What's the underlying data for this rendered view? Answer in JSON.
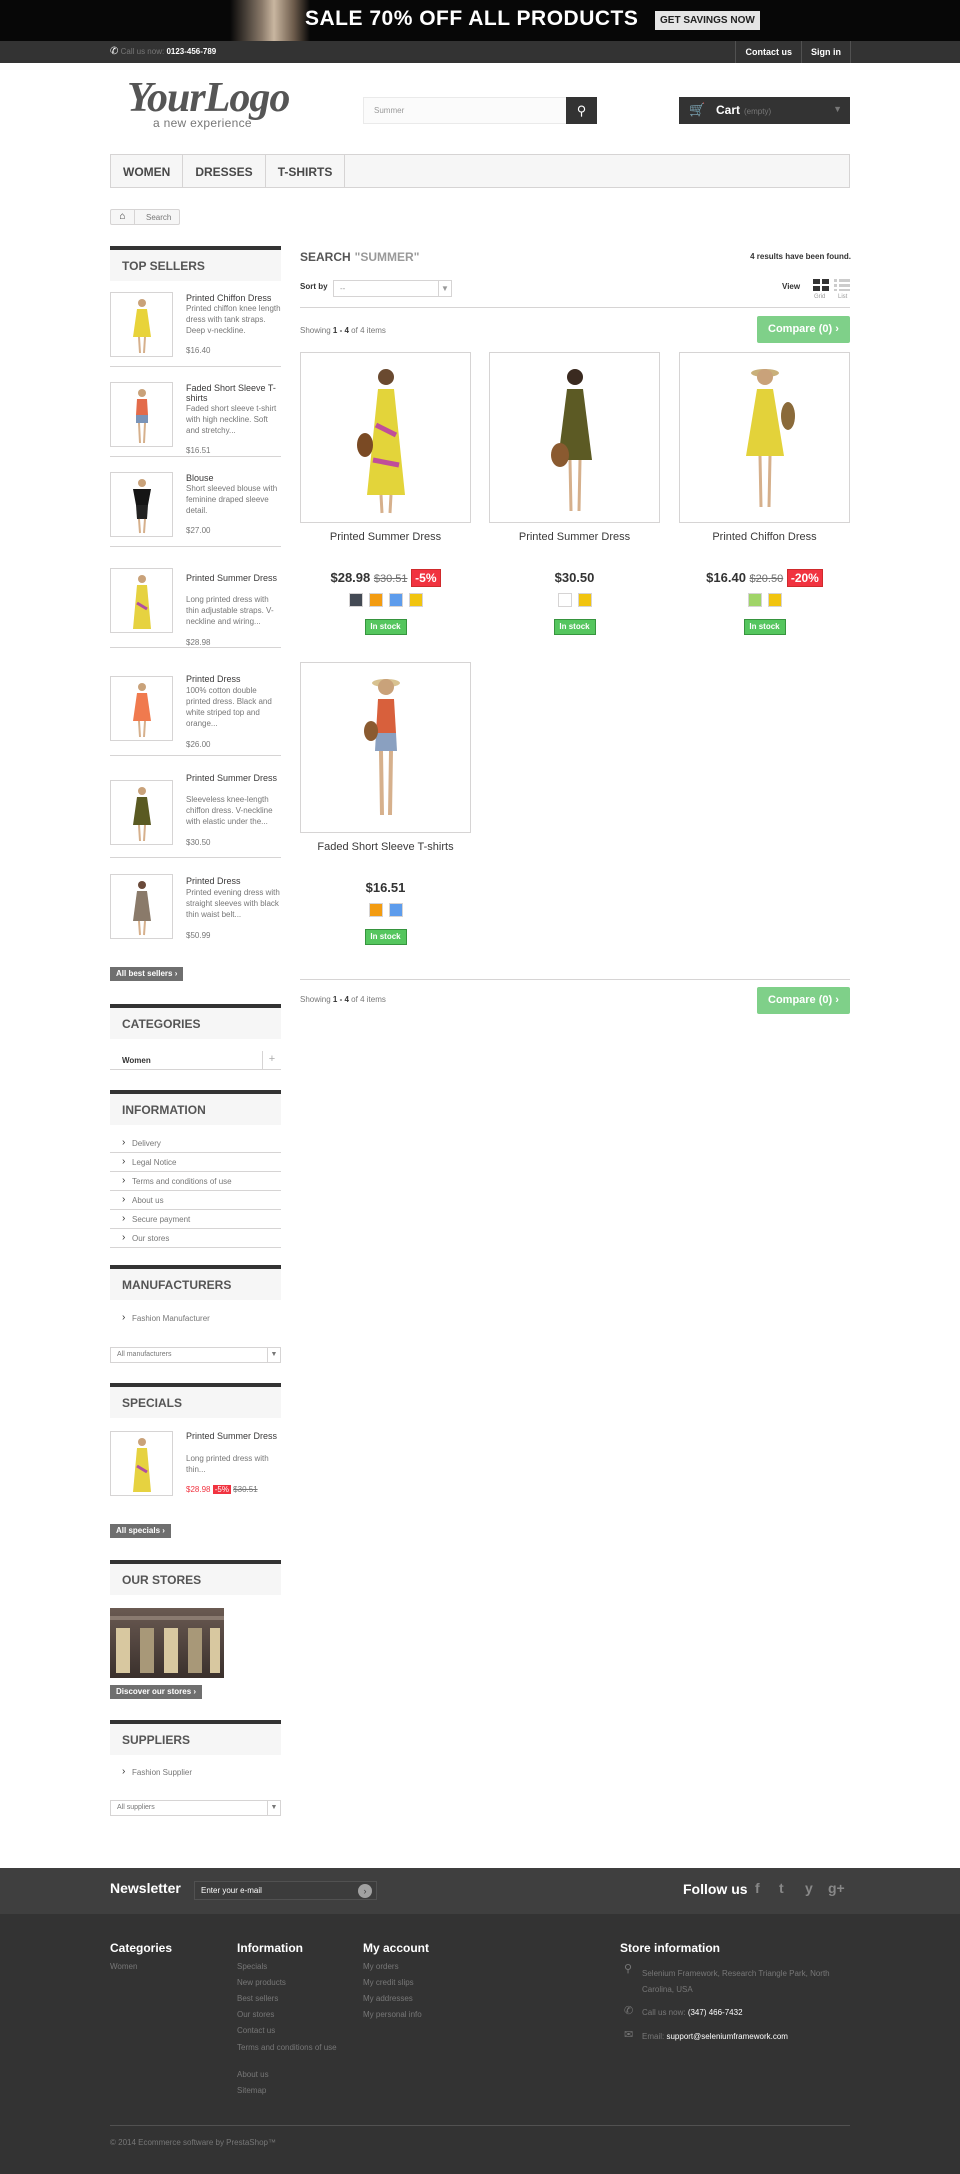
{
  "banner": {
    "headline": "SALE 70% OFF ALL PRODUCTS",
    "button": "GET SAVINGS NOW"
  },
  "topbar": {
    "call_label": "Call us now:",
    "phone": "0123-456-789",
    "links": [
      "Contact us",
      "Sign in"
    ]
  },
  "logo": {
    "main": "YourLogo",
    "tagline": "a new experience"
  },
  "search": {
    "placeholder": "Summer"
  },
  "cart": {
    "label": "Cart",
    "status": "(empty)"
  },
  "menu": [
    "WOMEN",
    "DRESSES",
    "T-SHIRTS"
  ],
  "breadcrumb": {
    "current": "Search"
  },
  "top_sellers": {
    "title": "TOP SELLERS",
    "items": [
      {
        "name": "Printed Chiffon Dress",
        "desc": "Printed chiffon knee length dress with tank straps. Deep v-neckline.",
        "price": "$16.40"
      },
      {
        "name": "Faded Short Sleeve T-shirts",
        "desc": "Faded short sleeve t-shirt with high neckline. Soft and stretchy...",
        "price": "$16.51"
      },
      {
        "name": "Blouse",
        "desc": "Short sleeved blouse with feminine draped sleeve detail.",
        "price": "$27.00"
      },
      {
        "name": "Printed Summer Dress",
        "desc": "Long printed dress with thin adjustable straps. V-neckline and wiring...",
        "price": "$28.98"
      },
      {
        "name": "Printed Dress",
        "desc": "100% cotton double printed dress. Black and white striped top and orange...",
        "price": "$26.00"
      },
      {
        "name": "Printed Summer Dress",
        "desc": "Sleeveless knee-length chiffon dress. V-neckline with elastic under the...",
        "price": "$30.50"
      },
      {
        "name": "Printed Dress",
        "desc": "Printed evening dress with straight sleeves with black thin waist belt...",
        "price": "$50.99"
      }
    ],
    "all_button": "All best sellers"
  },
  "categories": {
    "title": "CATEGORIES",
    "items": [
      "Women"
    ],
    "expand": "+"
  },
  "information": {
    "title": "INFORMATION",
    "items": [
      "Delivery",
      "Legal Notice",
      "Terms and conditions of use",
      "About us",
      "Secure payment",
      "Our stores"
    ]
  },
  "manufacturers": {
    "title": "MANUFACTURERS",
    "items": [
      "Fashion Manufacturer"
    ],
    "select": "All manufacturers"
  },
  "specials": {
    "title": "SPECIALS",
    "name": "Printed Summer Dress",
    "desc": "Long printed dress with thin...",
    "price": "$28.98",
    "discount": "-5%",
    "old_price": "$30.51",
    "all_button": "All specials"
  },
  "our_stores": {
    "title": "OUR STORES",
    "button": "Discover our stores"
  },
  "suppliers": {
    "title": "SUPPLIERS",
    "items": [
      "Fashion Supplier"
    ],
    "select": "All suppliers"
  },
  "results": {
    "label": "SEARCH",
    "query": "\"SUMMER\"",
    "count_text": "4 results have been found.",
    "sort_label": "Sort by",
    "sort_value": "--",
    "view_label": "View",
    "grid_label": "Grid",
    "list_label": "List",
    "showing_pre": "Showing",
    "showing_range": "1 - 4",
    "showing_post": "of 4 items",
    "compare": "Compare (0)"
  },
  "products": [
    {
      "name": "Printed Summer Dress",
      "price": "$28.98",
      "old_price": "$30.51",
      "discount": "-5%",
      "colors": [
        "#434a54",
        "#f39c11",
        "#5d9cec",
        "#f1c40f"
      ],
      "stock": "In stock"
    },
    {
      "name": "Printed Summer Dress",
      "price": "$30.50",
      "old_price": "",
      "discount": "",
      "colors": [
        "#ffffff",
        "#f1c40f"
      ],
      "stock": "In stock"
    },
    {
      "name": "Printed Chiffon Dress",
      "price": "$16.40",
      "old_price": "$20.50",
      "discount": "-20%",
      "colors": [
        "#a0d468",
        "#f1c40f"
      ],
      "stock": "In stock"
    },
    {
      "name": "Faded Short Sleeve T-shirts",
      "price": "$16.51",
      "old_price": "",
      "discount": "",
      "colors": [
        "#f39c11",
        "#5d9cec"
      ],
      "stock": "In stock"
    }
  ],
  "newsletter": {
    "title": "Newsletter",
    "placeholder": "Enter your e-mail",
    "follow": "Follow us",
    "social": [
      "f",
      "t",
      "y",
      "g+"
    ]
  },
  "footer": {
    "categories": {
      "title": "Categories",
      "items": [
        "Women"
      ]
    },
    "information": {
      "title": "Information",
      "items": [
        "Specials",
        "New products",
        "Best sellers",
        "Our stores",
        "Contact us",
        "Terms and conditions of use",
        "About us",
        "Sitemap"
      ]
    },
    "account": {
      "title": "My account",
      "items": [
        "My orders",
        "My credit slips",
        "My addresses",
        "My personal info"
      ]
    },
    "store": {
      "title": "Store information",
      "address": "Selenium Framework, Research Triangle Park, North Carolina, USA",
      "call_label": "Call us now:",
      "phone": "(347) 466-7432",
      "email_label": "Email:",
      "email": "support@seleniumframework.com"
    },
    "copyright": "© 2014 Ecommerce software by PrestaShop™"
  }
}
